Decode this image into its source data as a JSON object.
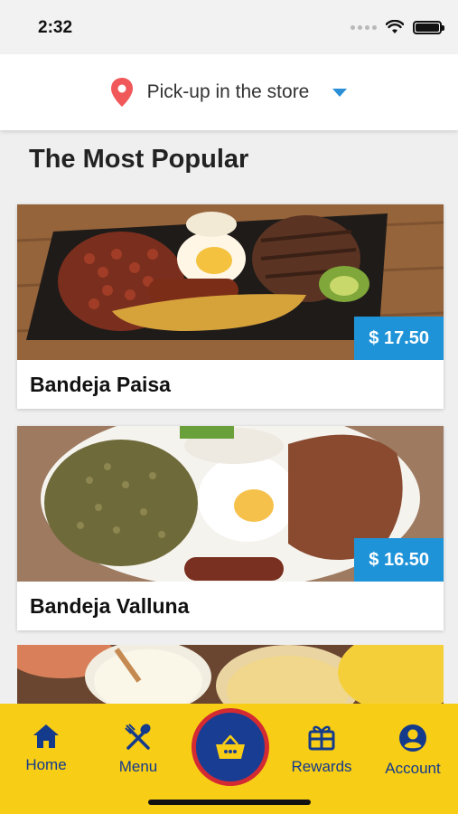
{
  "status": {
    "time": "2:32"
  },
  "pickup": {
    "label": "Pick-up in the store",
    "icon": "location-pin-icon",
    "pin_color": "#f0585a"
  },
  "section": {
    "title": "The Most Popular"
  },
  "items": [
    {
      "name": "Bandeja Paisa",
      "price": "$ 17.50"
    },
    {
      "name": "Bandeja Valluna",
      "price": "$ 16.50"
    }
  ],
  "nav": {
    "home": "Home",
    "menu": "Menu",
    "rewards": "Rewards",
    "account": "Account"
  },
  "colors": {
    "accent": "#1f93d8",
    "nav_bg": "#f7cd16",
    "nav_fg": "#143a8c",
    "basket_ring": "#d42b32"
  }
}
